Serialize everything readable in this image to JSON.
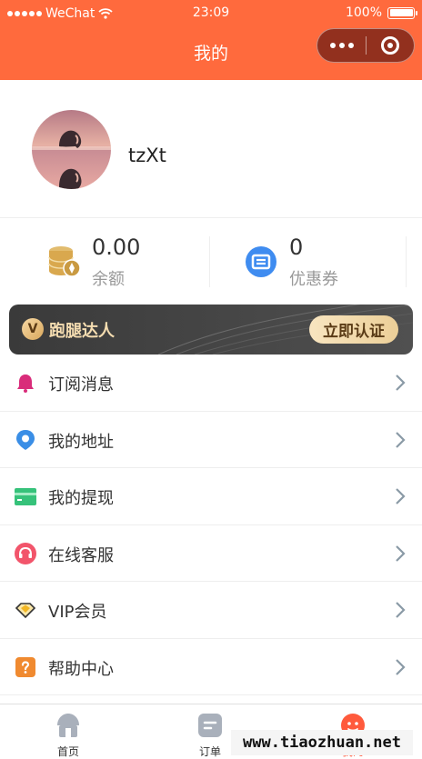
{
  "status_bar": {
    "carrier": "WeChat",
    "time": "23:09",
    "battery_text": "100%"
  },
  "nav": {
    "title": "我的"
  },
  "profile": {
    "username": "tzXt"
  },
  "stats": [
    {
      "value": "0.00",
      "label": "余额",
      "icon": "coins-icon"
    },
    {
      "value": "0",
      "label": "优惠券",
      "icon": "coupon-icon"
    }
  ],
  "vip_banner": {
    "badge": "V",
    "title": "跑腿达人",
    "button": "立即认证"
  },
  "menu": [
    {
      "label": "订阅消息",
      "icon": "bell-icon",
      "color": "#d92c7a"
    },
    {
      "label": "我的地址",
      "icon": "location-pin-icon",
      "color": "#3a8ee6"
    },
    {
      "label": "我的提现",
      "icon": "card-icon",
      "color": "#36c27a"
    },
    {
      "label": "在线客服",
      "icon": "headset-icon",
      "color": "#f2556b"
    },
    {
      "label": "VIP会员",
      "icon": "diamond-icon",
      "color": "#f1b624"
    },
    {
      "label": "帮助中心",
      "icon": "help-icon",
      "color": "#f08a30"
    }
  ],
  "tabbar": [
    {
      "label": "首页",
      "icon": "home-icon",
      "active": false
    },
    {
      "label": "订单",
      "icon": "order-icon",
      "active": false
    },
    {
      "label": "我的",
      "icon": "profile-face-icon",
      "active": true
    }
  ],
  "watermark": "www.tiaozhuan.net",
  "colors": {
    "brand": "#ff6a3d",
    "active_tab": "#ff5a3c",
    "vip_gold": "#f4dcb0"
  }
}
